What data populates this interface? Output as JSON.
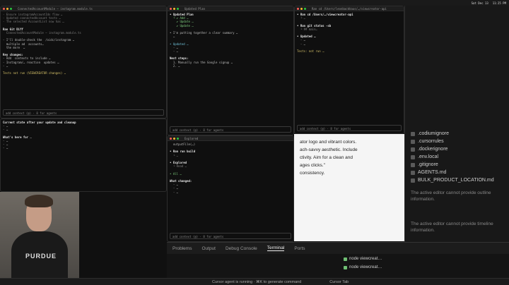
{
  "menubar": {
    "items": [
      "Sat Dec 13",
      "11:25 PM"
    ]
  },
  "terminals": {
    "t1": {
      "title": "ConnectedAccountModule — instagram.module.ts",
      "prompt": "add context (@) · 8 for agents"
    },
    "t2": {
      "title": "Updated Plan",
      "prompt": "add context (@) · 8 for agents"
    },
    "t3": {
      "title": "Ran cd /Users/leonbackhaus/…/viewcreator-api",
      "prompt": "add context (@) · 8 for agents"
    },
    "t4": {
      "title": "Explored",
      "prompt": "add context (@) · 8 for agents"
    }
  },
  "sidebar": {
    "items": [
      ".codiumignore",
      ".cursorrules",
      ".dockerignore",
      ".env.local",
      ".gitignore",
      "AGENTS.md",
      "BULK_PRODUCT_LOCATION.md"
    ],
    "outline_note": "The active editor cannot provide outline information.",
    "timeline_note": "The active editor cannot provide timeline information."
  },
  "doc": {
    "lines": [
      "ator logo and vibrant colors.",
      "ach-savvy aesthetic. Include",
      "ctivity. Aim for a clean and",
      "ages clicks.\"",
      "",
      "consistency."
    ]
  },
  "panel": {
    "tabs": [
      "Problems",
      "Output",
      "Debug Console",
      "Terminal",
      "Ports"
    ],
    "active": "Terminal"
  },
  "statusbar": {
    "left": "Cursor agent is running · ⌘K to generate command",
    "right": "Cursor Tab"
  },
  "nodes": [
    "node viewcreat…",
    "node viewcreat…"
  ],
  "webcam": {
    "logo": "PURDUE"
  }
}
